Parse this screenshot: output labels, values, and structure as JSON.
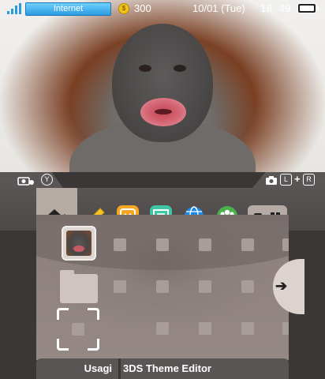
{
  "status_bar": {
    "connection_label": "Internet",
    "coin_count": "300",
    "date": "10/01 (Tue)",
    "time_hours": "18",
    "time_minutes": "49",
    "signal_icon": "signal-bars-icon",
    "coin_icon": "play-coin-icon",
    "battery_icon": "battery-icon",
    "battery_level": 1.0
  },
  "toolbar": {
    "left_tab": {
      "icon": "camera-icon",
      "button": "Y"
    },
    "right_tab": {
      "icon": "camera-icon",
      "buttons": [
        "L",
        "+",
        "R"
      ]
    },
    "settings_icon": "home-settings-icon",
    "apps": [
      "pencil-icon",
      "smiley-icon",
      "notification-icon",
      "globe-icon",
      "friends-icon"
    ],
    "view_modes": [
      "single-view-icon",
      "grid-view-icon"
    ]
  },
  "grid": {
    "scroll_arrow": "➔"
  },
  "footer": {
    "user_name": "Usagi",
    "software_title": "3DS Theme Editor"
  },
  "colors": {
    "accent_internet": "#2b9be0",
    "coin": "#f3c21a",
    "theme_base": "#5a5555",
    "theme_light": "#b6aaa5"
  }
}
